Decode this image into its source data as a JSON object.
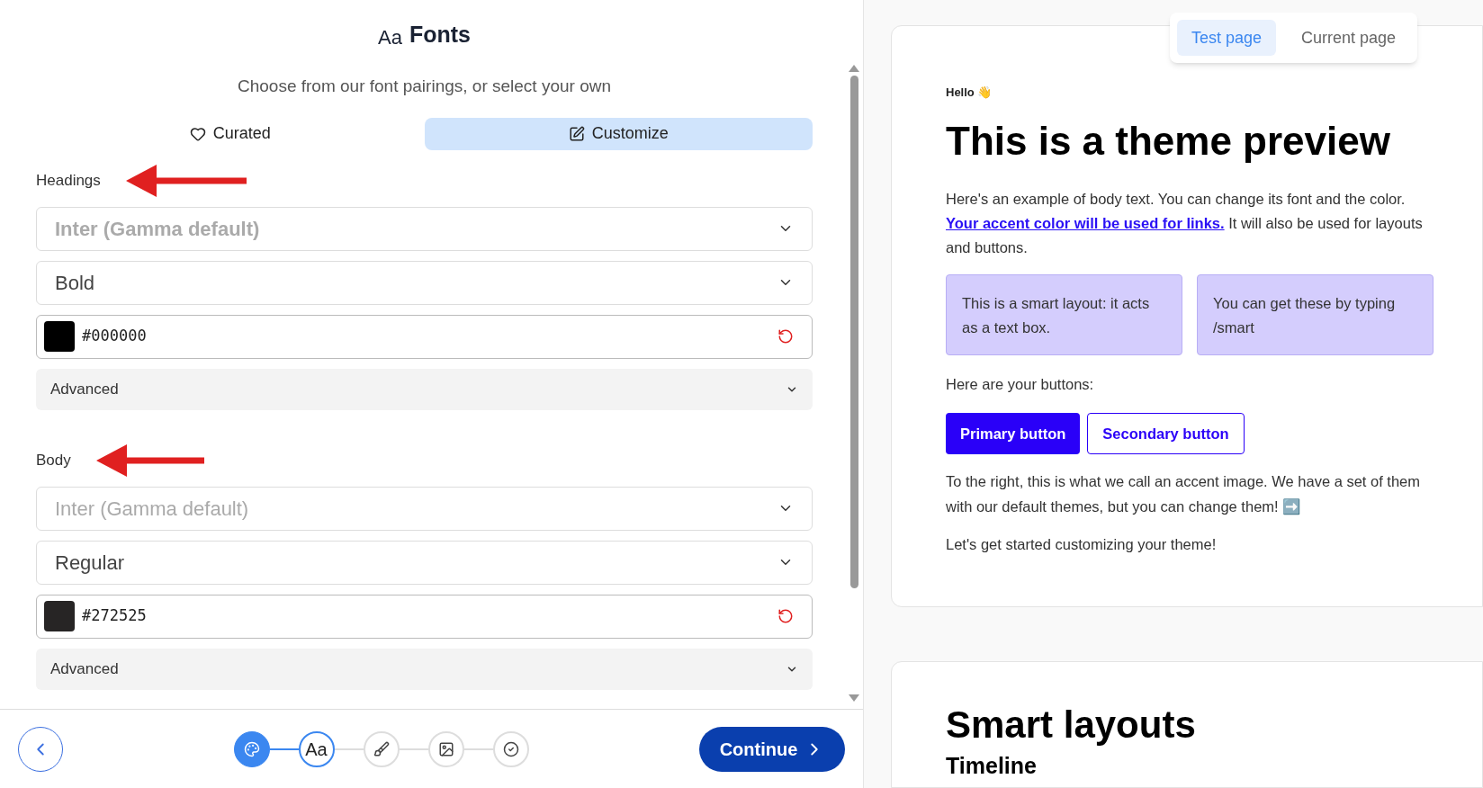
{
  "panel": {
    "title_icon": "Aa",
    "title": "Fonts",
    "subtitle": "Choose from our font pairings, or select your own",
    "tabs": [
      {
        "label": "Curated",
        "kind": "heart",
        "selected": false
      },
      {
        "label": "Customize",
        "kind": "edit",
        "selected": true
      }
    ],
    "sections": [
      {
        "label": "Headings",
        "font": {
          "placeholder": "Inter (Gamma default)",
          "bold": true
        },
        "weight": "Bold",
        "color": "#000000",
        "advanced": "Advanced"
      },
      {
        "label": "Body",
        "font": {
          "placeholder": "Inter (Gamma default)",
          "bold": false
        },
        "weight": "Regular",
        "color": "#272525",
        "advanced": "Advanced"
      }
    ]
  },
  "footer": {
    "steps": [
      {
        "kind": "palette",
        "done": true,
        "selected": false
      },
      {
        "kind": "text",
        "label": "Aa",
        "done": false,
        "selected": true
      },
      {
        "kind": "brush",
        "done": false,
        "selected": false
      },
      {
        "kind": "image",
        "done": false,
        "selected": false
      },
      {
        "kind": "check",
        "done": false,
        "selected": false
      }
    ],
    "continue": "Continue"
  },
  "preview": {
    "tabs": [
      {
        "label": "Test page",
        "selected": true
      },
      {
        "label": "Current page",
        "selected": false
      }
    ],
    "greeting": "Hello 👋",
    "heading": "This is a theme preview",
    "intro": "Here's an example of body text. You can change its font and the color.",
    "link": "Your accent color will be used for links.",
    "intro_end": "It will also be used for layouts and buttons.",
    "layouts": [
      "This is a smart layout: it acts as a text box.",
      "You can get these by typing /smart"
    ],
    "buttons_label": "Here are your buttons:",
    "primary": "Primary button",
    "secondary": "Secondary button",
    "accent": "To the right, this is what we call an accent image. We have a set of them with our default themes, but you can change them! ➡️",
    "closing": "Let's get started customizing your theme!",
    "next_heading": "Smart layouts",
    "next_subheading": "Timeline"
  }
}
